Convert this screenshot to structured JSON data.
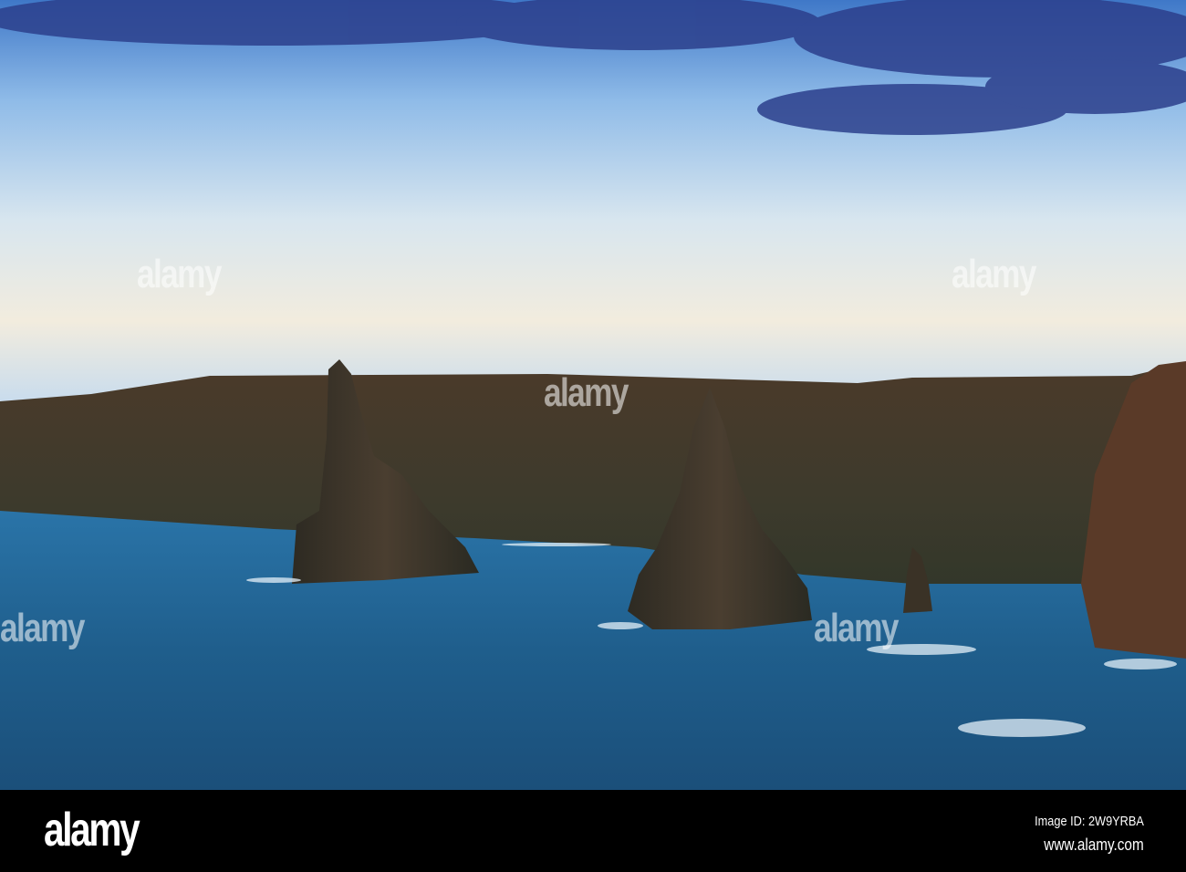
{
  "photo": {
    "subject": "sea stacks and cliffs",
    "watermark_text": "alamy"
  },
  "footer": {
    "logo": "alamy",
    "image_id": "Image ID: 2W9YRBA",
    "url": "www.alamy.com"
  },
  "colors": {
    "sky_top": "#3f78c8",
    "sky_horizon": "#f2ecde",
    "sea": "#1f5e8c",
    "cliff": "#3d3a2c"
  }
}
